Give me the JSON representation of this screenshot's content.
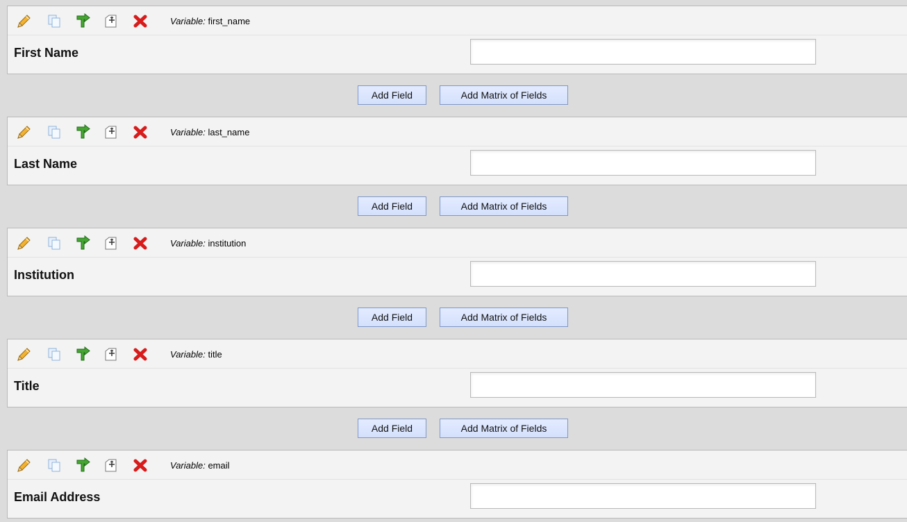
{
  "fields": [
    {
      "label": "First Name",
      "variable_label": "Variable:",
      "variable": "first_name",
      "value": ""
    },
    {
      "label": "Last Name",
      "variable_label": "Variable:",
      "variable": "last_name",
      "value": ""
    },
    {
      "label": "Institution",
      "variable_label": "Variable:",
      "variable": "institution",
      "value": ""
    },
    {
      "label": "Title",
      "variable_label": "Variable:",
      "variable": "title",
      "value": ""
    },
    {
      "label": "Email Address",
      "variable_label": "Variable:",
      "variable": "email",
      "value": ""
    }
  ],
  "buttons": {
    "add_field": "Add Field",
    "add_matrix": "Add Matrix of Fields"
  },
  "icons": [
    "pencil-icon",
    "copy-icon",
    "branch-icon",
    "move-icon",
    "delete-icon"
  ],
  "colors": {
    "panel_bg": "#f3f3f3",
    "bar_bg": "#dcdcdc",
    "button_bg": "#d9e4fd",
    "button_border": "#7e96c8",
    "delete_red": "#d81b1b",
    "branch_green": "#3f9a2c",
    "pencil_orange": "#f0a21b"
  }
}
